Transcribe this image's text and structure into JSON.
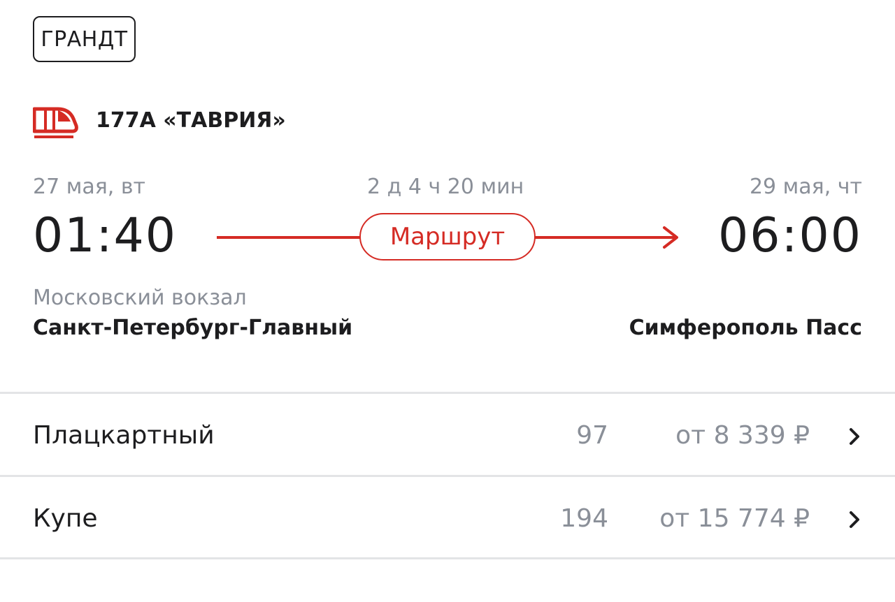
{
  "header": {
    "tag": "ГРАНДТ"
  },
  "train": {
    "name": "177А «ТАВРИЯ»",
    "icon": "train-icon"
  },
  "trip": {
    "departure": {
      "date": "27 мая, вт",
      "time": "01:40",
      "station_sub": "Московский вокзал",
      "station": "Санкт-Петербург-Главный"
    },
    "duration": "2 д 4 ч 20 мин",
    "route_label": "Маршрут",
    "arrival": {
      "date": "29 мая, чт",
      "time": "06:00",
      "station": "Симферополь Пасс"
    }
  },
  "classes": [
    {
      "name": "Плацкартный",
      "seats": "97",
      "price": "от 8 339 ₽"
    },
    {
      "name": "Купе",
      "seats": "194",
      "price": "от 15 774 ₽"
    }
  ],
  "colors": {
    "accent": "#d52b24",
    "text": "#1d1d1f",
    "muted": "#8a8f98",
    "divider": "#e3e4e6"
  }
}
